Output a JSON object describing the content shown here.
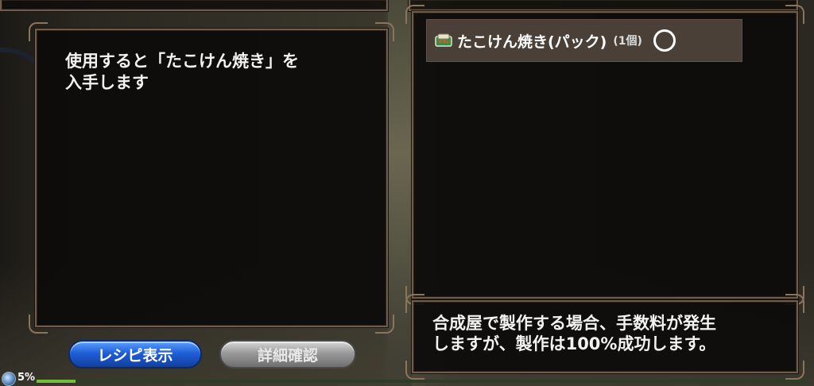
{
  "description": {
    "text": "使用すると「たこけん焼き」を\n入手します"
  },
  "item": {
    "icon": "food-pack-icon",
    "name": "たこけん焼き(パック)",
    "count": "(1個)",
    "status_icon": "circle-ok-icon"
  },
  "info": {
    "text": "合成屋で製作する場合、手数料が発生\nしますが、製作は100%成功します。"
  },
  "buttons": {
    "recipe_label": "レシピ表示",
    "detail_label": "詳細確認"
  },
  "status": {
    "percent_label": "5%",
    "progress": 0.05
  },
  "colors": {
    "panel_bg": "#0c0b0a",
    "panel_border": "#6e5c4a",
    "item_row_bg": "#4a4038",
    "recipe_button": "#1f5fd8",
    "detail_button": "#9a9a9a",
    "progress_fill": "#6fbf3b"
  }
}
